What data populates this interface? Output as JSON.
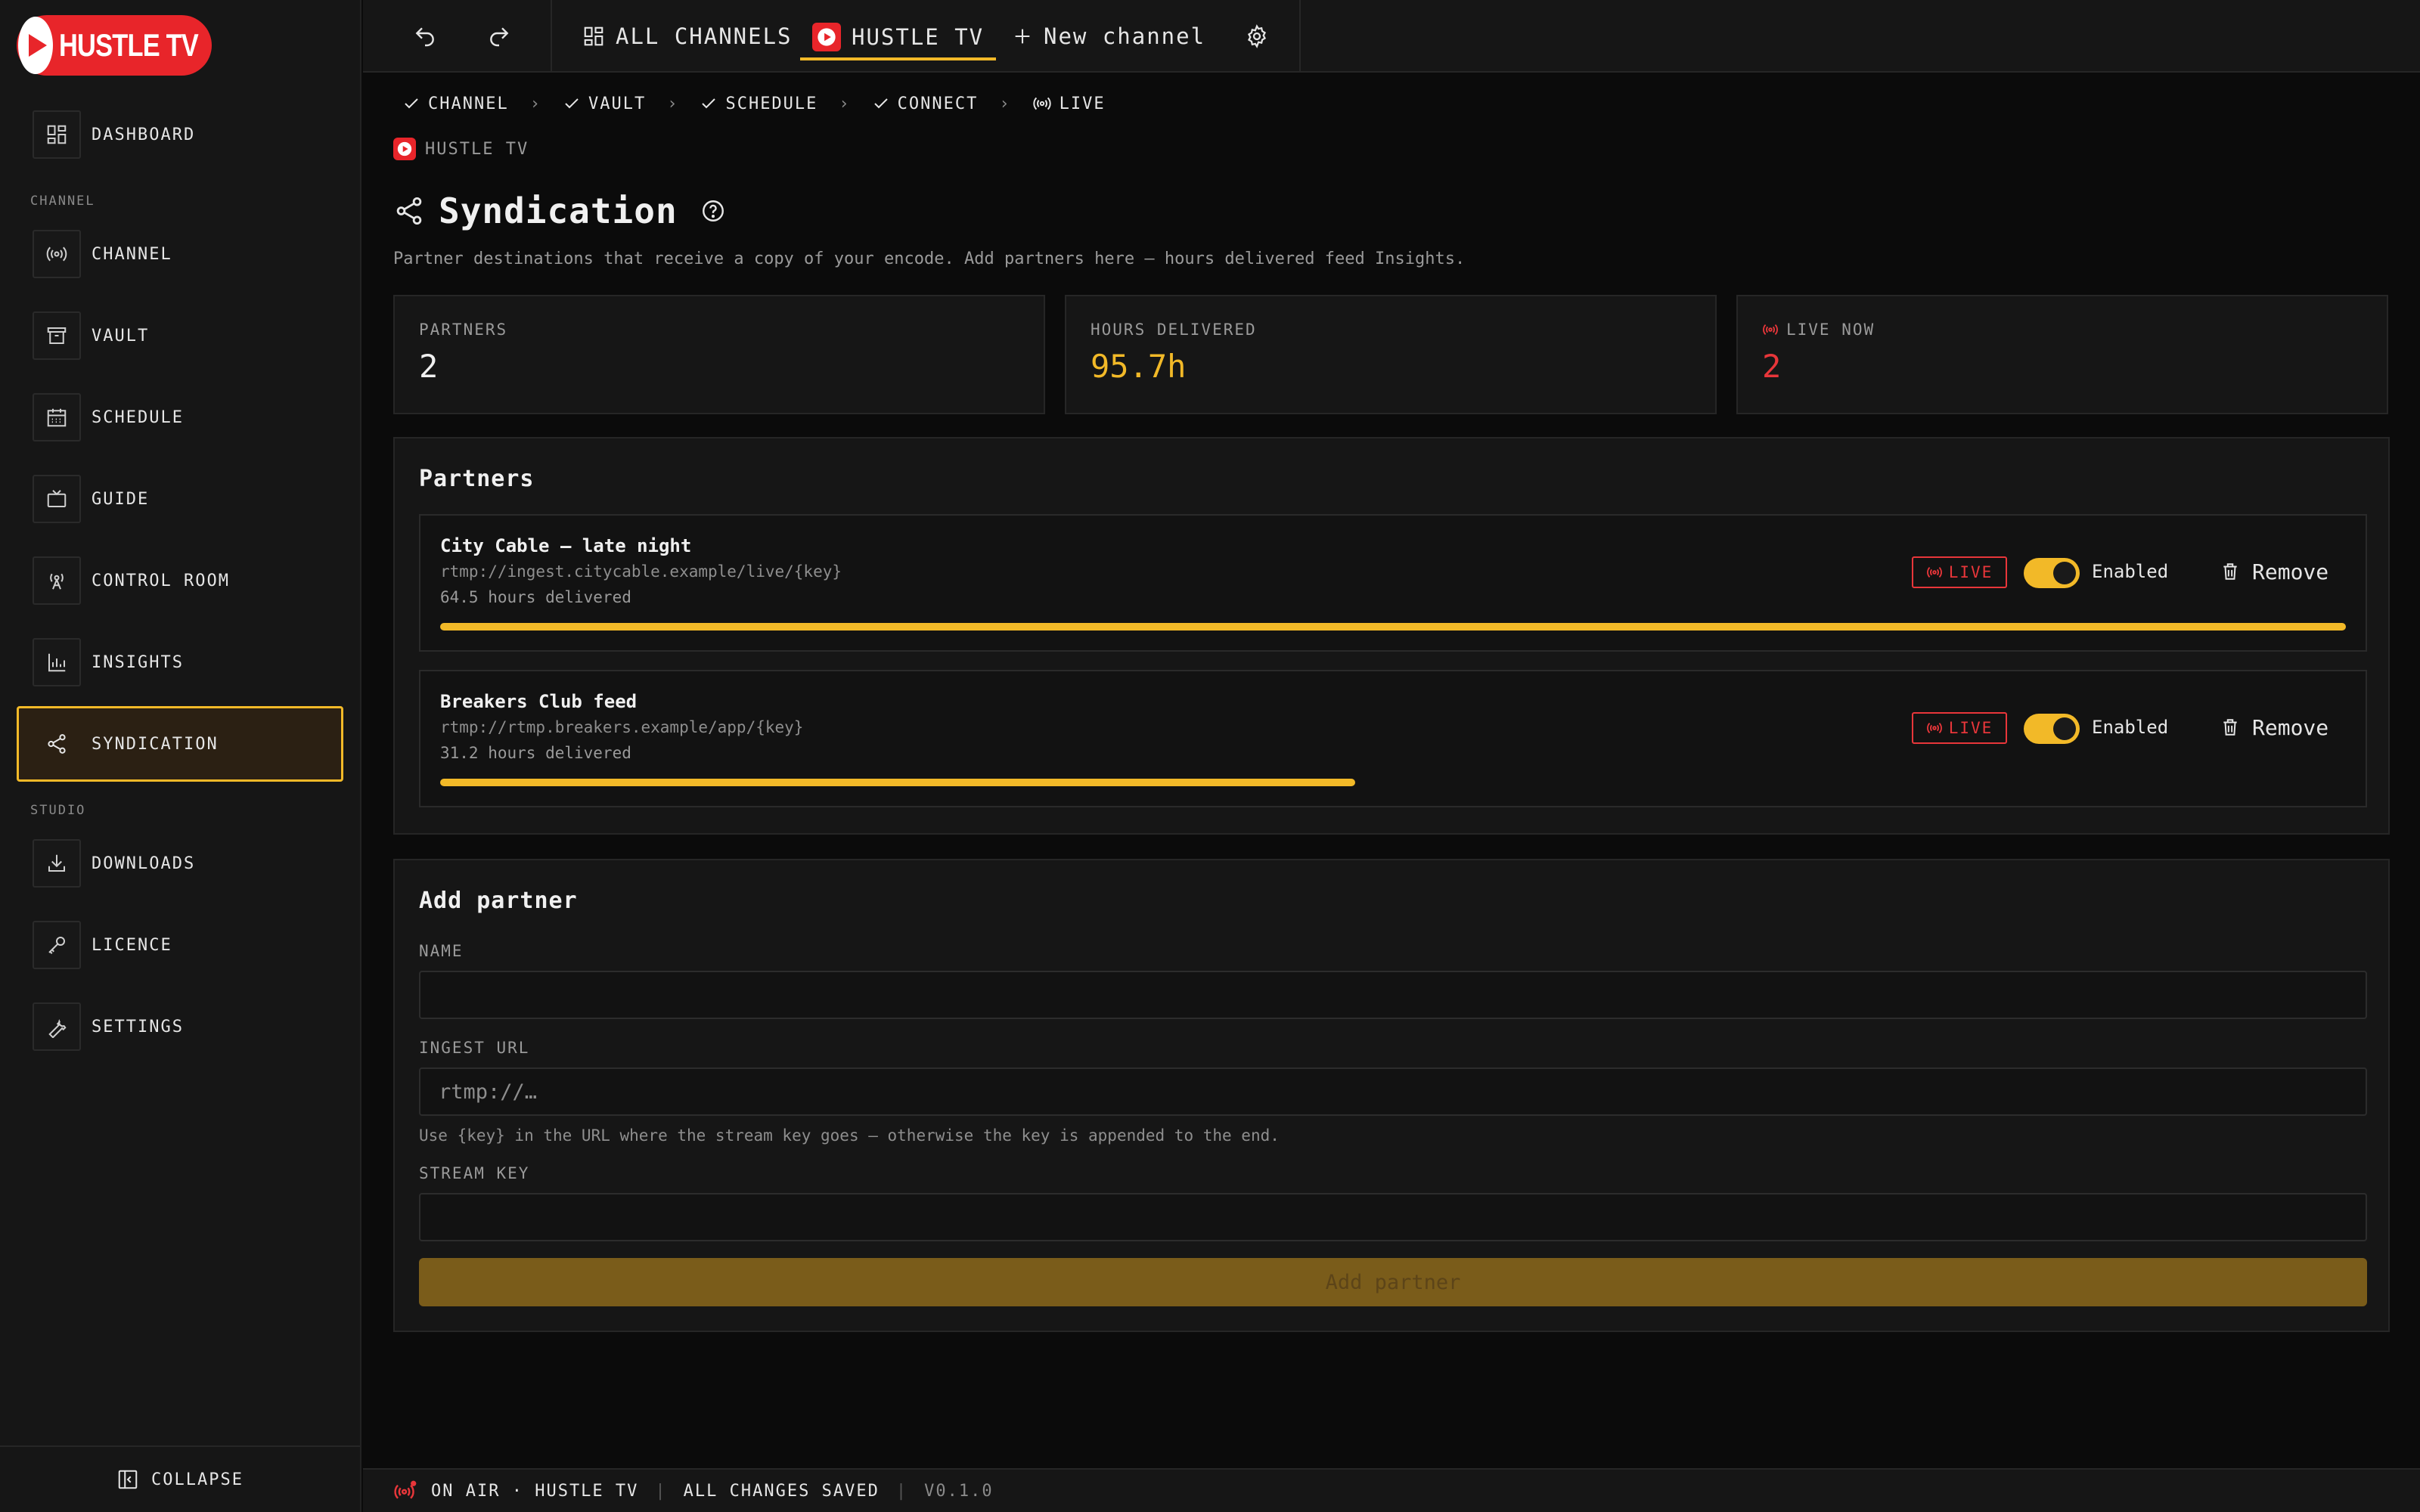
{
  "brand": {
    "name": "HUSTLE TV",
    "accent": "#f2b928",
    "live_color": "#e8363a",
    "logo_red": "#e8252a"
  },
  "sidebar": {
    "top_item": {
      "label": "DASHBOARD",
      "icon": "dashboard-icon"
    },
    "sections": [
      {
        "title": "CHANNEL",
        "items": [
          {
            "label": "CHANNEL",
            "icon": "broadcast-icon"
          },
          {
            "label": "VAULT",
            "icon": "archive-icon"
          },
          {
            "label": "SCHEDULE",
            "icon": "calendar-icon"
          },
          {
            "label": "GUIDE",
            "icon": "tv-icon"
          },
          {
            "label": "CONTROL ROOM",
            "icon": "antenna-icon"
          },
          {
            "label": "INSIGHTS",
            "icon": "bar-chart-icon"
          },
          {
            "label": "SYNDICATION",
            "icon": "share-icon",
            "active": true
          }
        ]
      },
      {
        "title": "STUDIO",
        "items": [
          {
            "label": "DOWNLOADS",
            "icon": "download-icon"
          },
          {
            "label": "LICENCE",
            "icon": "key-icon"
          },
          {
            "label": "SETTINGS",
            "icon": "wrench-icon"
          }
        ]
      }
    ],
    "collapse_label": "COLLAPSE"
  },
  "topbar": {
    "tabs": [
      {
        "label": "ALL CHANNELS",
        "icon": "grid-icon"
      },
      {
        "label": "HUSTLE TV",
        "icon": "play-logo-icon",
        "active": true
      },
      {
        "label": "New channel",
        "icon": "plus-icon"
      }
    ]
  },
  "stepper": {
    "steps": [
      {
        "label": "CHANNEL",
        "icon": "check-icon"
      },
      {
        "label": "VAULT",
        "icon": "check-icon"
      },
      {
        "label": "SCHEDULE",
        "icon": "check-icon"
      },
      {
        "label": "CONNECT",
        "icon": "check-icon"
      },
      {
        "label": "LIVE",
        "icon": "broadcast-icon"
      }
    ],
    "separator": "›"
  },
  "channel_chip": "HUSTLE TV",
  "page": {
    "title": "Syndication",
    "description": "Partner destinations that receive a copy of your encode. Add partners here — hours delivered feed Insights."
  },
  "stats": [
    {
      "label": "PARTNERS",
      "value": "2",
      "color": "#f0f0f0"
    },
    {
      "label": "HOURS DELIVERED",
      "value": "95.7h",
      "color": "#f2b928"
    },
    {
      "label": "LIVE NOW",
      "value": "2",
      "color": "#e8363a"
    }
  ],
  "partners": {
    "title": "Partners",
    "items": [
      {
        "name": "City Cable — late night",
        "url": "rtmp://ingest.citycable.example/live/{key}",
        "hours": "64.5 hours delivered",
        "hours_value": 64.5,
        "progress": 1.0,
        "badge": "LIVE",
        "toggle_label": "Enabled",
        "remove_label": "Remove"
      },
      {
        "name": "Breakers Club feed",
        "url": "rtmp://rtmp.breakers.example/app/{key}",
        "hours": "31.2 hours delivered",
        "hours_value": 31.2,
        "progress": 0.48,
        "badge": "LIVE",
        "toggle_label": "Enabled",
        "remove_label": "Remove"
      }
    ]
  },
  "add_partner": {
    "title": "Add partner",
    "name_label": "NAME",
    "name_value": "",
    "url_label": "INGEST URL",
    "url_placeholder": "rtmp://…",
    "url_hint": "Use {key} in the URL where the stream key goes — otherwise the key is appended to the end.",
    "key_label": "STREAM KEY",
    "key_value": "",
    "button_label": "Add partner"
  },
  "statusbar": {
    "on_air": "ON AIR · HUSTLE TV",
    "saved": "ALL CHANGES SAVED",
    "version": "V0.1.0"
  }
}
